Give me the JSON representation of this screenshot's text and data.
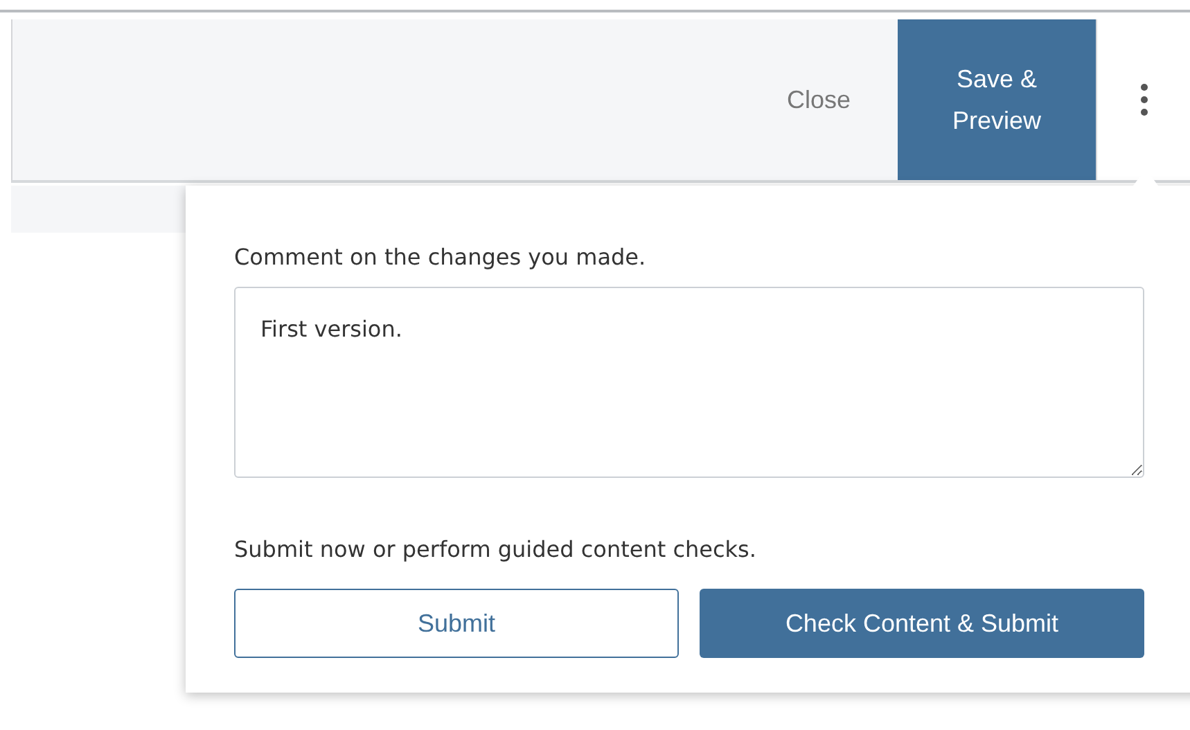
{
  "toolbar": {
    "close_label": "Close",
    "save_label": "Save &\nPreview",
    "more_menu": {
      "expanded": true
    }
  },
  "popover": {
    "comment_label": "Comment on the changes you made.",
    "comment_value": "First version.",
    "submit_label": "Submit now or perform guided content checks.",
    "buttons": [
      {
        "label": "Submit",
        "kind": "outline"
      },
      {
        "label": "Check Content & Submit",
        "kind": "primary"
      }
    ]
  }
}
